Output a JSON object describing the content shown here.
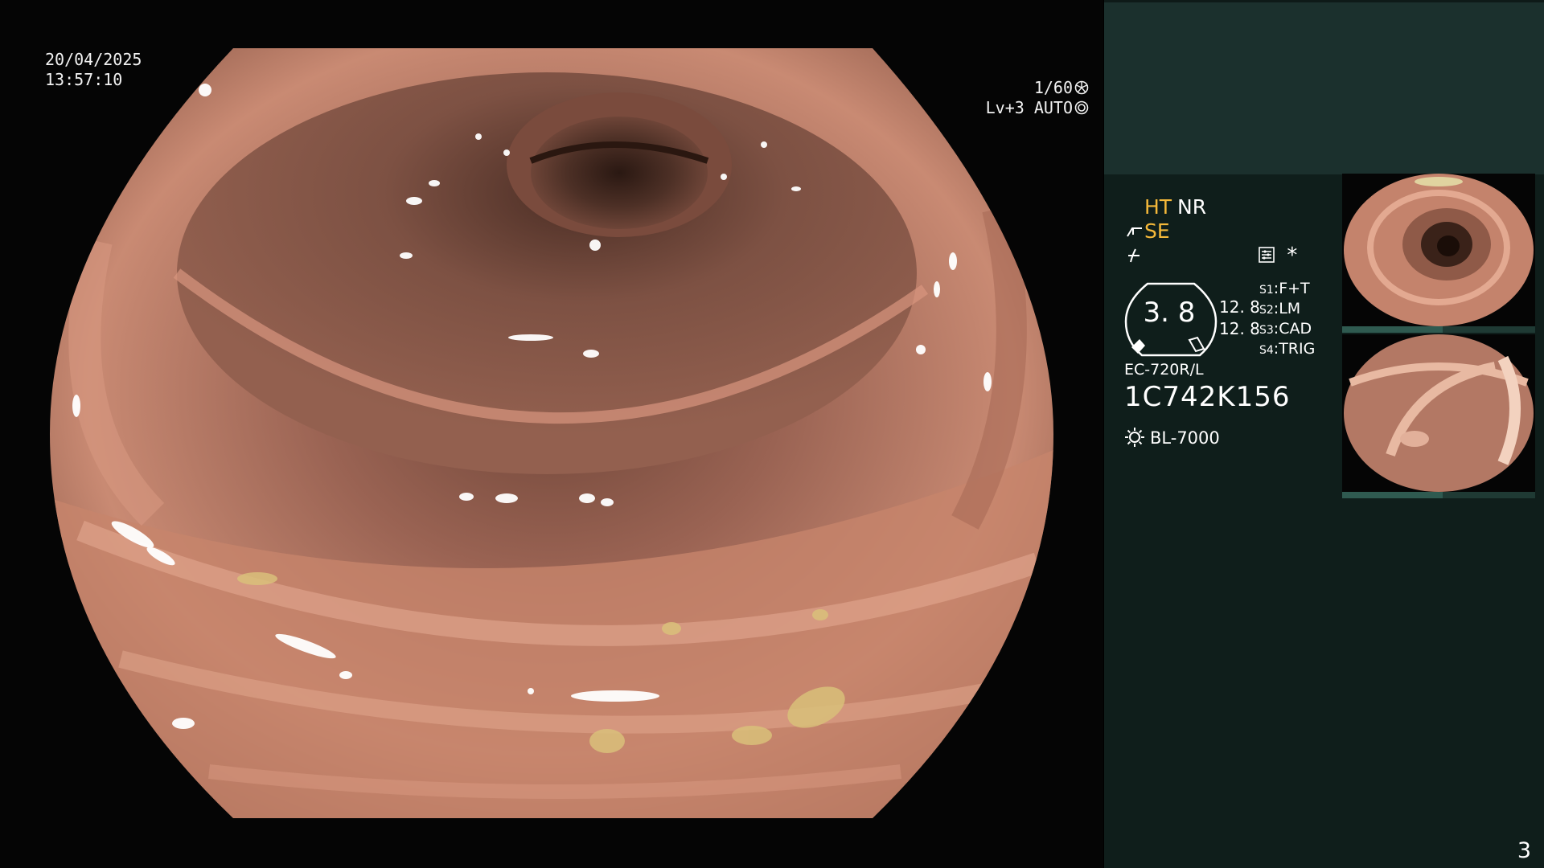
{
  "overlay": {
    "date": "20/04/2025",
    "time": "13:57:10",
    "shutter": "1/60",
    "level": "Lv+3",
    "iris_mode": "AUTO"
  },
  "panel": {
    "mode_ht": "HT",
    "mode_nr": "NR",
    "mode_se": "SE",
    "gauge_value": "3. 8",
    "gauge_upper": "12. 8",
    "gauge_lower": "12. 8",
    "switches": [
      {
        "key": "S1",
        "value": "F+T"
      },
      {
        "key": "S2",
        "value": "LM"
      },
      {
        "key": "S3",
        "value": "CAD"
      },
      {
        "key": "S4",
        "value": "TRIG"
      }
    ],
    "asterisk": "*",
    "scope_model": "EC-720R/L",
    "scope_serial": "1C742K156",
    "light_source": "BL-7000",
    "page_number": "3"
  },
  "icons": [
    "shutter-icon",
    "iris-icon",
    "scope-bend-icon",
    "freeze-icon",
    "settings-icon",
    "light-source-icon"
  ],
  "colors": {
    "panel_background": "#0f1e1b",
    "panel_header": "#1b302d",
    "status_amber": "#f5b93a",
    "mucosa": "#c98a73"
  }
}
